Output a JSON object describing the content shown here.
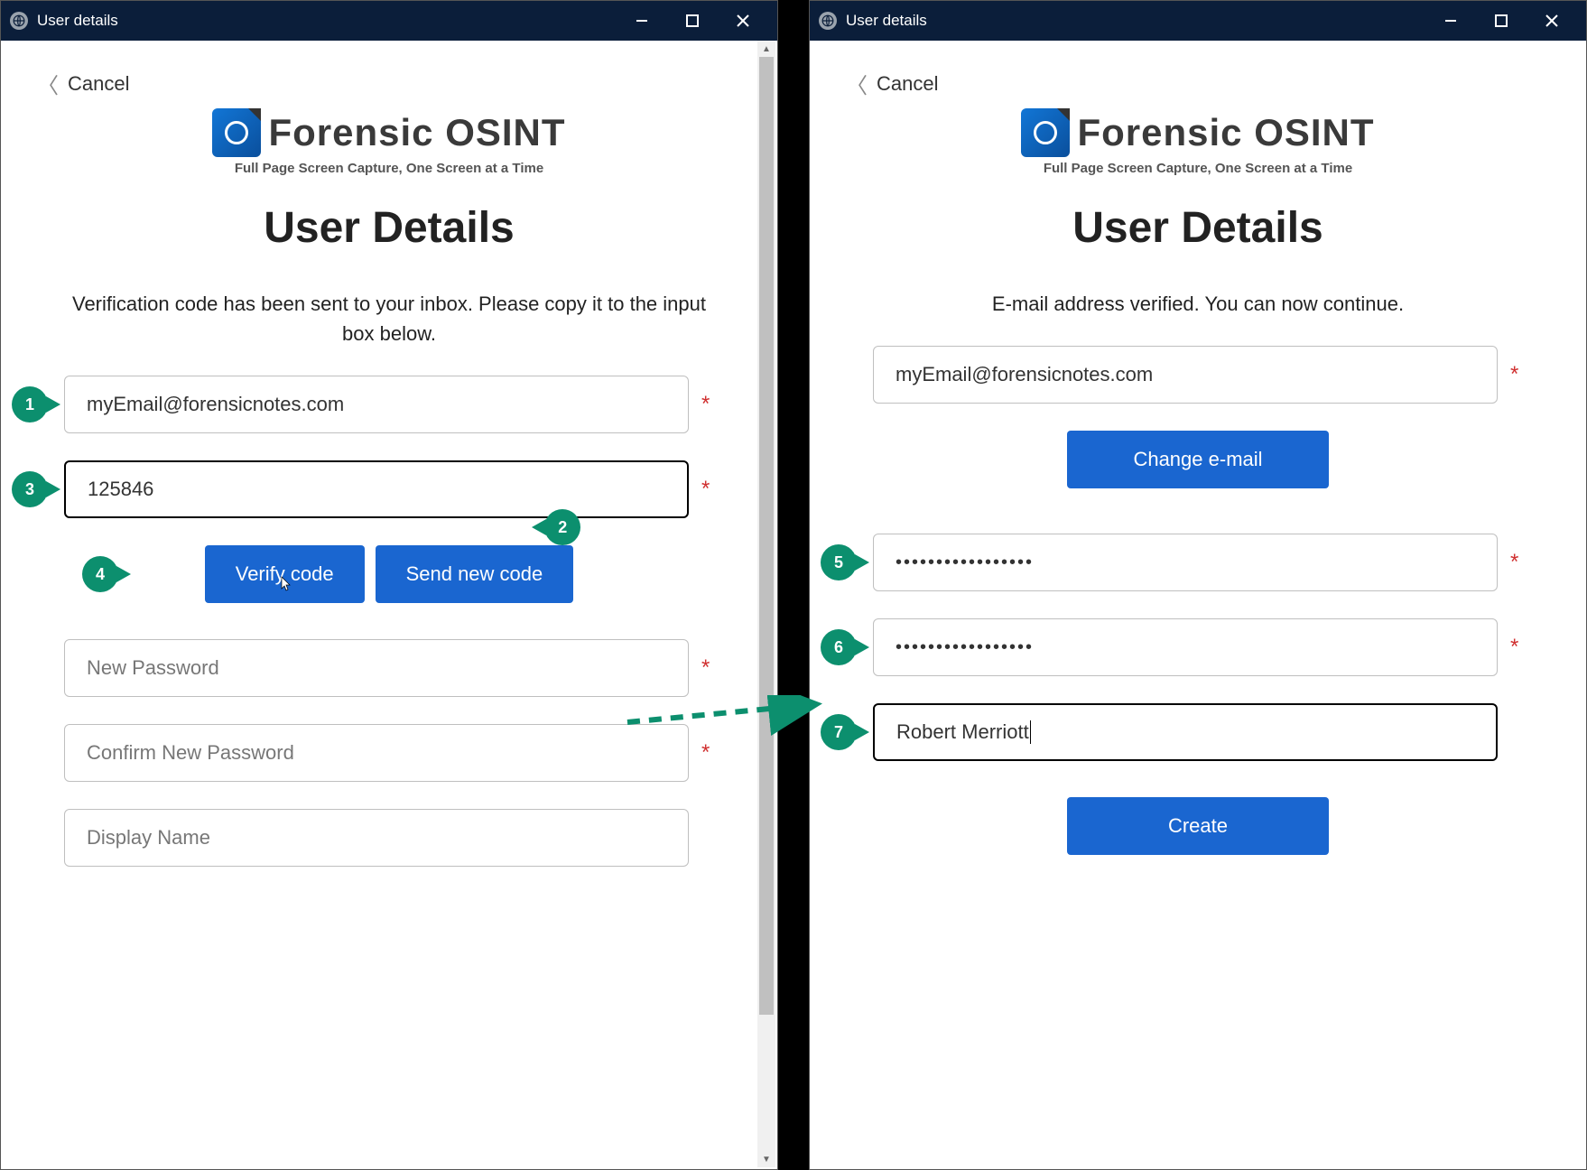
{
  "titlebar": {
    "title": "User details"
  },
  "nav": {
    "cancel": "Cancel"
  },
  "brand": {
    "name": "Forensic OSINT",
    "tagline": "Full Page Screen Capture, One Screen at a Time"
  },
  "page_title": "User Details",
  "left": {
    "instruction": "Verification code has been sent to your inbox. Please copy it to the input box below.",
    "email_value": "myEmail@forensicnotes.com",
    "code_value": "125846",
    "verify_label": "Verify code",
    "send_new_label": "Send new code",
    "new_password_placeholder": "New Password",
    "confirm_password_placeholder": "Confirm New Password",
    "display_name_placeholder": "Display Name"
  },
  "right": {
    "instruction": "E-mail address verified. You can now continue.",
    "email_value": "myEmail@forensicnotes.com",
    "change_email_label": "Change e-mail",
    "password_mask": "•••••••••••••••••",
    "confirm_mask": "•••••••••••••••••",
    "display_name_value": "Robert Merriott",
    "create_label": "Create"
  },
  "callouts": {
    "c1": "1",
    "c2": "2",
    "c3": "3",
    "c4": "4",
    "c5": "5",
    "c6": "6",
    "c7": "7"
  },
  "required_mark": "*"
}
